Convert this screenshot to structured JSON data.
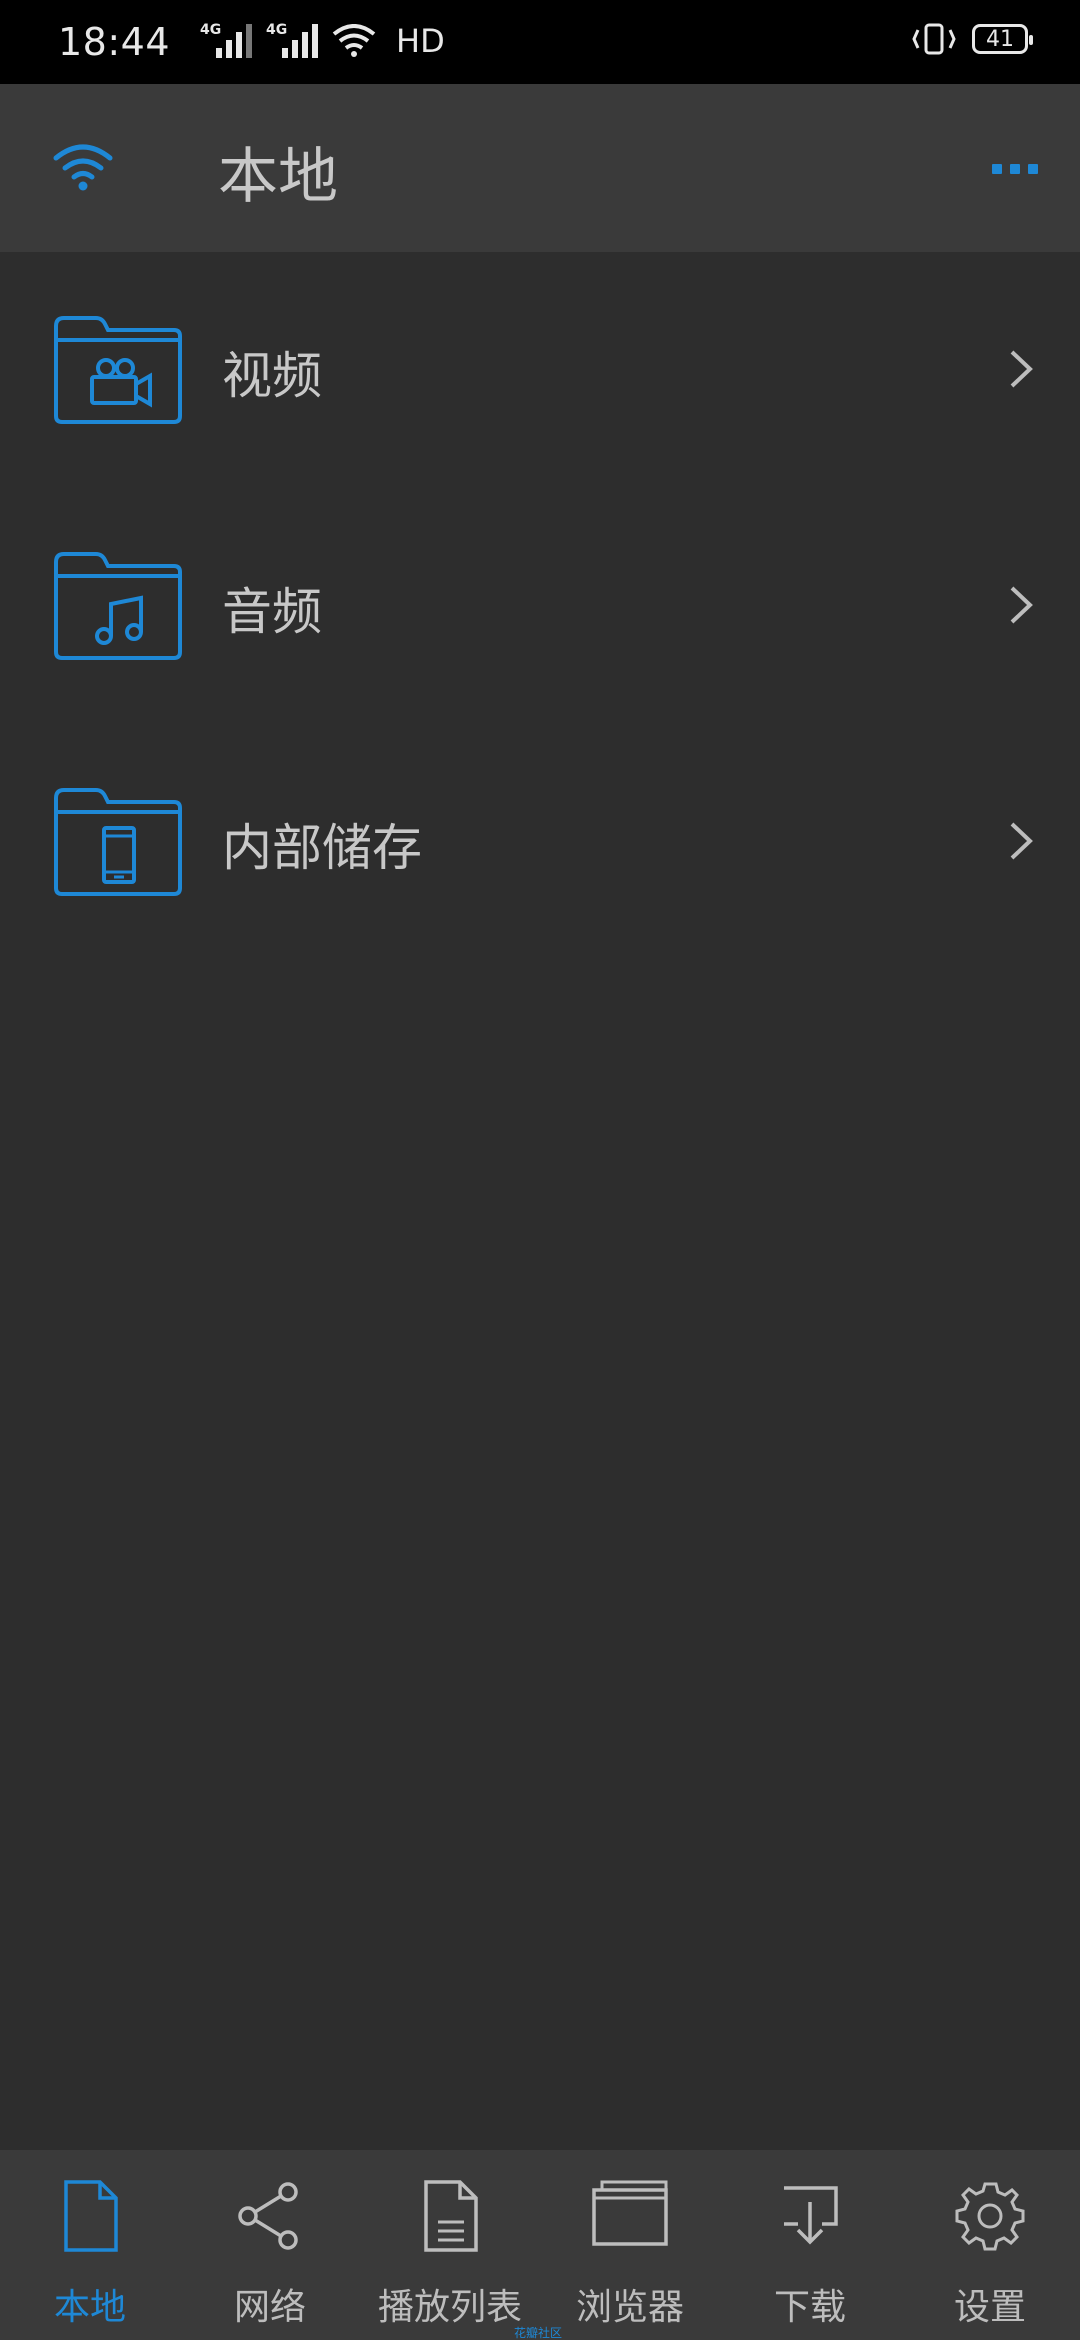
{
  "status_bar": {
    "time": "18:44",
    "sim1_tag": "4G",
    "sim2_tag": "4G",
    "hd_label": "HD",
    "battery_level": "41"
  },
  "app_bar": {
    "title": "本地",
    "wifi_icon": "wifi-icon",
    "more_icon": "more-dots-icon",
    "accent_color": "#1e88d6"
  },
  "folders": [
    {
      "label": "视频",
      "icon": "video-folder-icon"
    },
    {
      "label": "音频",
      "icon": "music-folder-icon"
    },
    {
      "label": "内部储存",
      "icon": "phone-folder-icon"
    }
  ],
  "bottom_nav": {
    "items": [
      {
        "label": "本地",
        "icon": "file-icon",
        "active": true
      },
      {
        "label": "网络",
        "icon": "share-icon",
        "active": false
      },
      {
        "label": "播放列表",
        "icon": "document-icon",
        "active": false
      },
      {
        "label": "浏览器",
        "icon": "window-icon",
        "active": false
      },
      {
        "label": "下载",
        "icon": "download-icon",
        "active": false
      },
      {
        "label": "设置",
        "icon": "gear-icon",
        "active": false
      }
    ]
  },
  "watermark": "花瓣社区"
}
